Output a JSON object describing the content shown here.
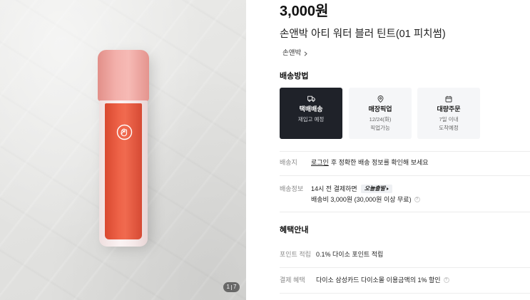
{
  "gallery": {
    "current": "1",
    "total": "7"
  },
  "product": {
    "price": "3,000원",
    "name": "손앤박 아티 워터 블러 틴트(01 피치썸)",
    "brand": "손앤박"
  },
  "delivery_method": {
    "title": "배송방법",
    "options": [
      {
        "icon": "truck-icon",
        "label": "택배배송",
        "sub": [
          "재입고 예정"
        ],
        "selected": true
      },
      {
        "icon": "location-pin-icon",
        "label": "매장픽업",
        "sub": [
          "12/24(화)",
          "픽업가능"
        ],
        "selected": false
      },
      {
        "icon": "calendar-icon",
        "label": "대량주문",
        "sub": [
          "7일 이내",
          "도착예정"
        ],
        "selected": false
      }
    ]
  },
  "shipping_address": {
    "label": "배송지",
    "login_link": "로그인",
    "message": "후 정확한 배송 정보를 확인해 보세요"
  },
  "shipping_info": {
    "label": "배송정보",
    "cutoff_text": "14시 전 결제하면",
    "badge": "오늘출발",
    "fee_text": "배송비 3,000원 (30,000원 이상 무료)",
    "info_glyph": "?"
  },
  "benefits": {
    "title": "혜택안내",
    "rows": [
      {
        "label": "포인트 적립",
        "text": "0.1% 다이소 포인트 적립"
      },
      {
        "label": "결제 혜택",
        "text": "다이소 삼성카드 다이소몰 이용금액의 1% 할인",
        "info_glyph": "?"
      }
    ]
  },
  "colors": {
    "selected_card_bg": "#1f2229",
    "card_bg": "#f5f6f8",
    "text": "#1a1a1a",
    "muted": "#8a8a8a",
    "divider": "#ececec",
    "tint": "#ee6348",
    "cap": "#f3b0ab"
  }
}
